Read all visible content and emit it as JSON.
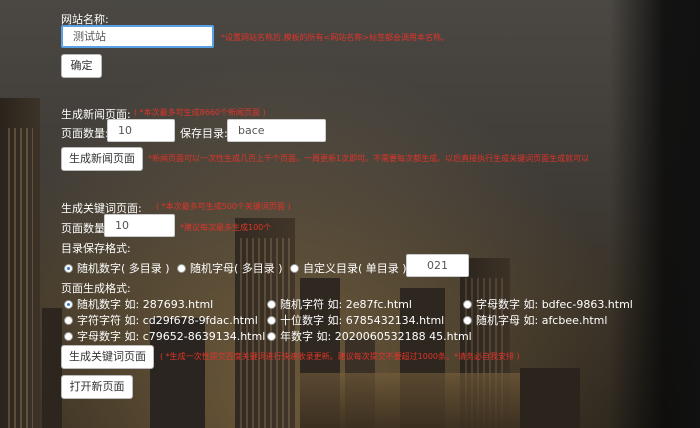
{
  "site_name": {
    "label": "网站名称:",
    "value": "测试站",
    "hint": "*设置网站名称后,模板的所有<网站名称>标签都会调用本名称。",
    "confirm_label": "确定"
  },
  "news": {
    "title": "生成新闻页面:",
    "title_hint": "( *本次最多可生成8660个新闻页面 )",
    "count_label": "页面数量:",
    "count_value": "10",
    "dir_label": "保存目录:",
    "dir_value": "bace",
    "button_label": "生成新闻页面",
    "button_hint": "*新闻页面可以一次性生成几百上千个页面。一周更新1次即可。不需要每次都生成。以后直接执行生成关键词页面生成就可以"
  },
  "keywords": {
    "title": "生成关键词页面:",
    "title_hint": "( *本次最多可生成500个关键词页面 )",
    "count_label": "页面数量:",
    "count_value": "10",
    "count_hint": "*建议每次最多生成100个",
    "dir_format_label": "目录保存格式:",
    "dir_options": [
      {
        "label": "随机数字( 多目录 )",
        "selected": true
      },
      {
        "label": "随机字母( 多目录 )",
        "selected": false
      },
      {
        "label": "自定义目录( 单目录 )",
        "selected": false
      }
    ],
    "custom_dir_value": "021",
    "page_format_label": "页面生成格式:",
    "page_formats": [
      {
        "label": "随机数字 如: 287693.html",
        "selected": true
      },
      {
        "label": "随机字符 如: 2e87fc.html",
        "selected": false
      },
      {
        "label": "字母数字 如: bdfec-9863.html",
        "selected": false
      },
      {
        "label": "字符字符 如: cd29f678-9fdac.html",
        "selected": false
      },
      {
        "label": "十位数字 如: 6785432134.html",
        "selected": false
      },
      {
        "label": "随机字母 如: afcbee.html",
        "selected": false
      },
      {
        "label": "字母数字 如: c79652-8639134.html",
        "selected": false
      },
      {
        "label": "年数字 如: 2020060532188 45.html",
        "selected": false
      }
    ],
    "button_label": "生成关键词页面",
    "button_hint": "( *生成一次性提交百度关键词进行快速收录更新。建议每次提交不要超过1000条。*请务必自我安排 )"
  },
  "open_page_label": "打开新页面"
}
